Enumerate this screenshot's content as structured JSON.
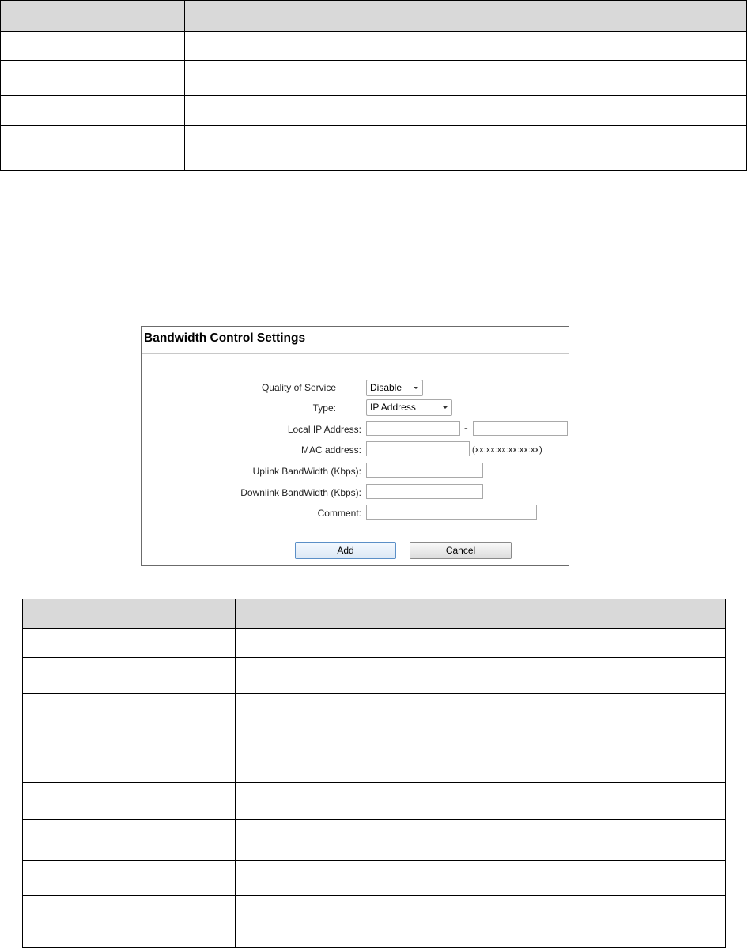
{
  "panel": {
    "title": "Bandwidth Control Settings",
    "labels": {
      "qos": "Quality of Service",
      "type": "Type:",
      "local_ip": "Local IP Address:",
      "mac": "MAC address:",
      "uplink": "Uplink BandWidth (Kbps):",
      "downlink": "Downlink BandWidth (Kbps):",
      "comment": "Comment:"
    },
    "qos_value": "Disable",
    "type_value": "IP Address",
    "ip_separator": "-",
    "mac_hint": "(xx:xx:xx:xx:xx:xx)",
    "add_label": "Add",
    "cancel_label": "Cancel"
  },
  "top_table": {
    "header": [
      "",
      ""
    ],
    "rows": [
      [
        "",
        ""
      ],
      [
        "",
        ""
      ],
      [
        "",
        ""
      ],
      [
        "",
        ""
      ]
    ]
  },
  "bottom_table": {
    "header": [
      "",
      ""
    ],
    "rows": [
      [
        "",
        ""
      ],
      [
        "",
        ""
      ],
      [
        "",
        ""
      ],
      [
        "",
        ""
      ],
      [
        "",
        ""
      ],
      [
        "",
        ""
      ],
      [
        "",
        ""
      ],
      [
        "",
        ""
      ]
    ]
  }
}
